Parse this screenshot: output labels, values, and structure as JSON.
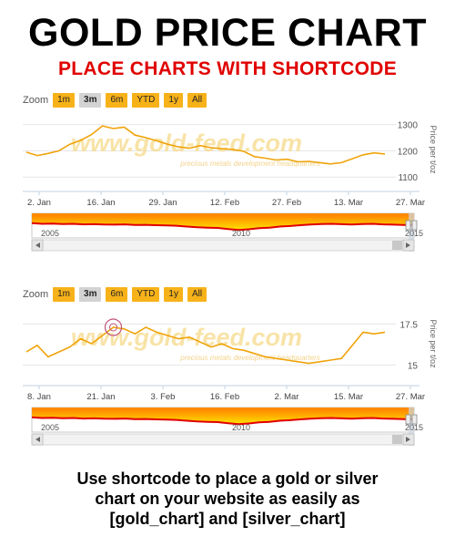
{
  "header": {
    "title": "GOLD PRICE CHART",
    "subtitle": "PLACE CHARTS WITH SHORTCODE"
  },
  "watermark": {
    "text": "www.gold-feed.com",
    "tagline": "precious metals development headquarters"
  },
  "colors": {
    "accent": "#f7b21a",
    "line": "#f0a30a",
    "navigator_red": "#e00000",
    "subtitle": "#e00000"
  },
  "charts": [
    {
      "zoom": {
        "label": "Zoom",
        "buttons": [
          "1m",
          "3m",
          "6m",
          "YTD",
          "1y",
          "All"
        ],
        "active": "3m"
      },
      "ylabel": "Price per t/oz",
      "yticks": [
        "1300",
        "1200",
        "1100"
      ],
      "xticks": [
        "2. Jan",
        "16. Jan",
        "29. Jan",
        "12. Feb",
        "27. Feb",
        "13. Mar",
        "27. Mar"
      ],
      "nav_labels": [
        "2005",
        "2010",
        "2015"
      ]
    },
    {
      "zoom": {
        "label": "Zoom",
        "buttons": [
          "1m",
          "3m",
          "6m",
          "YTD",
          "1y",
          "All"
        ],
        "active": "3m"
      },
      "ylabel": "Price per t/oz",
      "yticks": [
        "17.5",
        "15"
      ],
      "xticks": [
        "8. Jan",
        "21. Jan",
        "3. Feb",
        "16. Feb",
        "2. Mar",
        "15. Mar",
        "27. Mar"
      ],
      "nav_labels": [
        "2005",
        "2010",
        "2015"
      ]
    }
  ],
  "chart_data": [
    {
      "type": "line",
      "title": "",
      "xlabel": "",
      "ylabel": "Price per t/oz",
      "ylim": [
        1080,
        1330
      ],
      "x": [
        "2. Jan",
        "16. Jan",
        "29. Jan",
        "12. Feb",
        "27. Feb",
        "13. Mar",
        "27. Mar"
      ],
      "series": [
        {
          "values": [
            1195,
            1182,
            1190,
            1200,
            1225,
            1240,
            1262,
            1295,
            1285,
            1290,
            1260,
            1250,
            1238,
            1225,
            1215,
            1210,
            1220,
            1212,
            1208,
            1205,
            1198,
            1178,
            1172,
            1165,
            1168,
            1158,
            1160,
            1155,
            1150,
            1155,
            1170,
            1185,
            1192,
            1188
          ]
        }
      ]
    },
    {
      "type": "line",
      "title": "",
      "xlabel": "",
      "ylabel": "Price per t/oz",
      "ylim": [
        14.3,
        18.3
      ],
      "x": [
        "8. Jan",
        "21. Jan",
        "3. Feb",
        "16. Feb",
        "2. Mar",
        "15. Mar",
        "27. Mar"
      ],
      "series": [
        {
          "values": [
            15.8,
            16.2,
            15.5,
            15.8,
            16.1,
            16.6,
            16.3,
            16.8,
            17.3,
            17.2,
            16.9,
            17.3,
            17.0,
            16.8,
            16.6,
            16.7,
            16.4,
            16.1,
            16.3,
            16.0,
            15.9,
            15.7,
            15.5,
            15.4,
            15.3,
            15.2,
            15.1,
            15.2,
            15.3,
            15.4,
            16.2,
            17.0,
            16.9,
            17.0
          ]
        }
      ]
    }
  ],
  "footer": {
    "line1": "Use shortcode to place a gold or silver",
    "line2": "chart on your website as easily as",
    "line3": "[gold_chart] and [silver_chart]"
  }
}
